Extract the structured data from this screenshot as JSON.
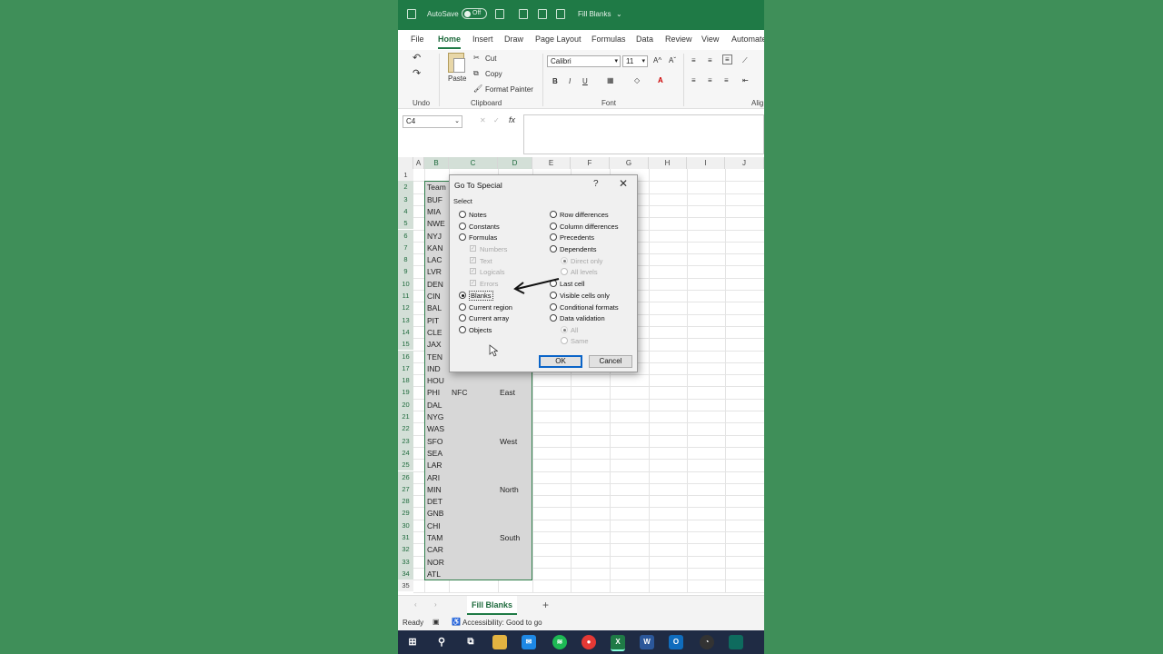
{
  "titlebar": {
    "autosave_label": "AutoSave",
    "autosave_state": "Off",
    "file_name": "Fill Blanks"
  },
  "tabs": [
    "File",
    "Home",
    "Insert",
    "Draw",
    "Page Layout",
    "Formulas",
    "Data",
    "Review",
    "View",
    "Automate"
  ],
  "active_tab": "Home",
  "ribbon": {
    "undo_group": "Undo",
    "paste": "Paste",
    "cut": "Cut",
    "copy": "Copy",
    "format_painter": "Format Painter",
    "clipboard_group": "Clipboard",
    "font_name": "Calibri",
    "font_size": "11",
    "font_group": "Font",
    "bold": "B",
    "italic": "I",
    "underline": "U",
    "alignment_group": "Alig"
  },
  "formula_bar": {
    "name_box": "C4",
    "fx": "fx"
  },
  "grid": {
    "columns": [
      "A",
      "B",
      "C",
      "D",
      "E",
      "F",
      "G",
      "H",
      "I",
      "J"
    ],
    "rows": [
      "1",
      "2",
      "3",
      "4",
      "5",
      "6",
      "7",
      "8",
      "9",
      "10",
      "11",
      "12",
      "13",
      "14",
      "15",
      "16",
      "17",
      "18",
      "19",
      "20",
      "21",
      "22",
      "23",
      "24",
      "25",
      "26",
      "27",
      "28",
      "29",
      "30",
      "31",
      "32",
      "33",
      "34",
      "35"
    ],
    "col_b": [
      "Team",
      "BUF",
      "MIA",
      "NWE",
      "NYJ",
      "KAN",
      "LAC",
      "LVR",
      "DEN",
      "CIN",
      "BAL",
      "PIT",
      "CLE",
      "JAX",
      "TEN",
      "IND",
      "HOU",
      "PHI",
      "DAL",
      "NYG",
      "WAS",
      "SFO",
      "SEA",
      "LAR",
      "ARI",
      "MIN",
      "DET",
      "GNB",
      "CHI",
      "TAM",
      "CAR",
      "NOR",
      "ATL"
    ],
    "c19": "NFC",
    "d19": "East",
    "d23": "West",
    "d27": "North",
    "d31": "South"
  },
  "dialog": {
    "title": "Go To Special",
    "help": "?",
    "close": "✕",
    "select_label": "Select",
    "left_options": [
      "Notes",
      "Constants",
      "Formulas"
    ],
    "formula_checks": [
      "Numbers",
      "Text",
      "Logicals",
      "Errors"
    ],
    "left_options_2": [
      "Blanks",
      "Current region",
      "Current array",
      "Objects"
    ],
    "right_options": [
      "Row differences",
      "Column differences",
      "Precedents",
      "Dependents"
    ],
    "dependents_sub": [
      "Direct only",
      "All levels"
    ],
    "right_options_2": [
      "Last cell",
      "Visible cells only",
      "Conditional formats",
      "Data validation"
    ],
    "validation_sub": [
      "All",
      "Same"
    ],
    "selected": "Blanks",
    "ok": "OK",
    "cancel": "Cancel"
  },
  "sheet_tab": "Fill Blanks",
  "status": {
    "ready": "Ready",
    "accessibility": "Accessibility: Good to go"
  },
  "colors": {
    "background": "#3f8f59",
    "excel_green": "#1f7a46"
  }
}
